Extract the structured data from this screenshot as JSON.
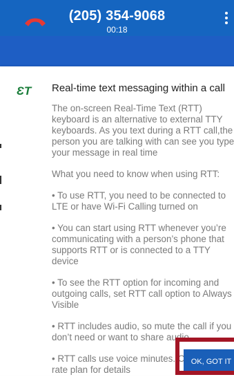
{
  "call": {
    "number": "(205) 354-9068",
    "duration": "00:18"
  },
  "icons": {
    "end_call": "phone-hangup-icon",
    "more": "more-vert-icon",
    "rtt": "rtt-icon"
  },
  "rtt_info": {
    "icon_glyph": "ƐT",
    "title": "Real-time text messaging within a call",
    "paragraphs": [
      "The on-screen Real-Time Text (RTT) keyboard is an alternative to external TTY keyboards. As you text during a RTT call,the person you are talking with can see you type your message in real time",
      "What you need to know when using RTT:",
      "• To use RTT, you need to be connected to LTE or have Wi-Fi Calling turned on",
      "• You can start using RTT whenever you’re communicating with a person’s phone that supports RTT or is connected to a TTY device",
      "• To see the RTT option for incoming and outgoing calls, set RTT call option to Always Visible",
      "• RTT includes audio, so mute the call if you don’t need or want to share audio",
      "• RTT calls use voice minutes. Check your rate plan for details"
    ],
    "ok_label": "OK, GOT IT"
  },
  "colors": {
    "app_bar": "#1565c0",
    "end_call_red": "#e53935",
    "rtt_icon_green": "#1a7d3a",
    "button_blue": "#1a5fb8",
    "highlight_red": "#a31525"
  }
}
